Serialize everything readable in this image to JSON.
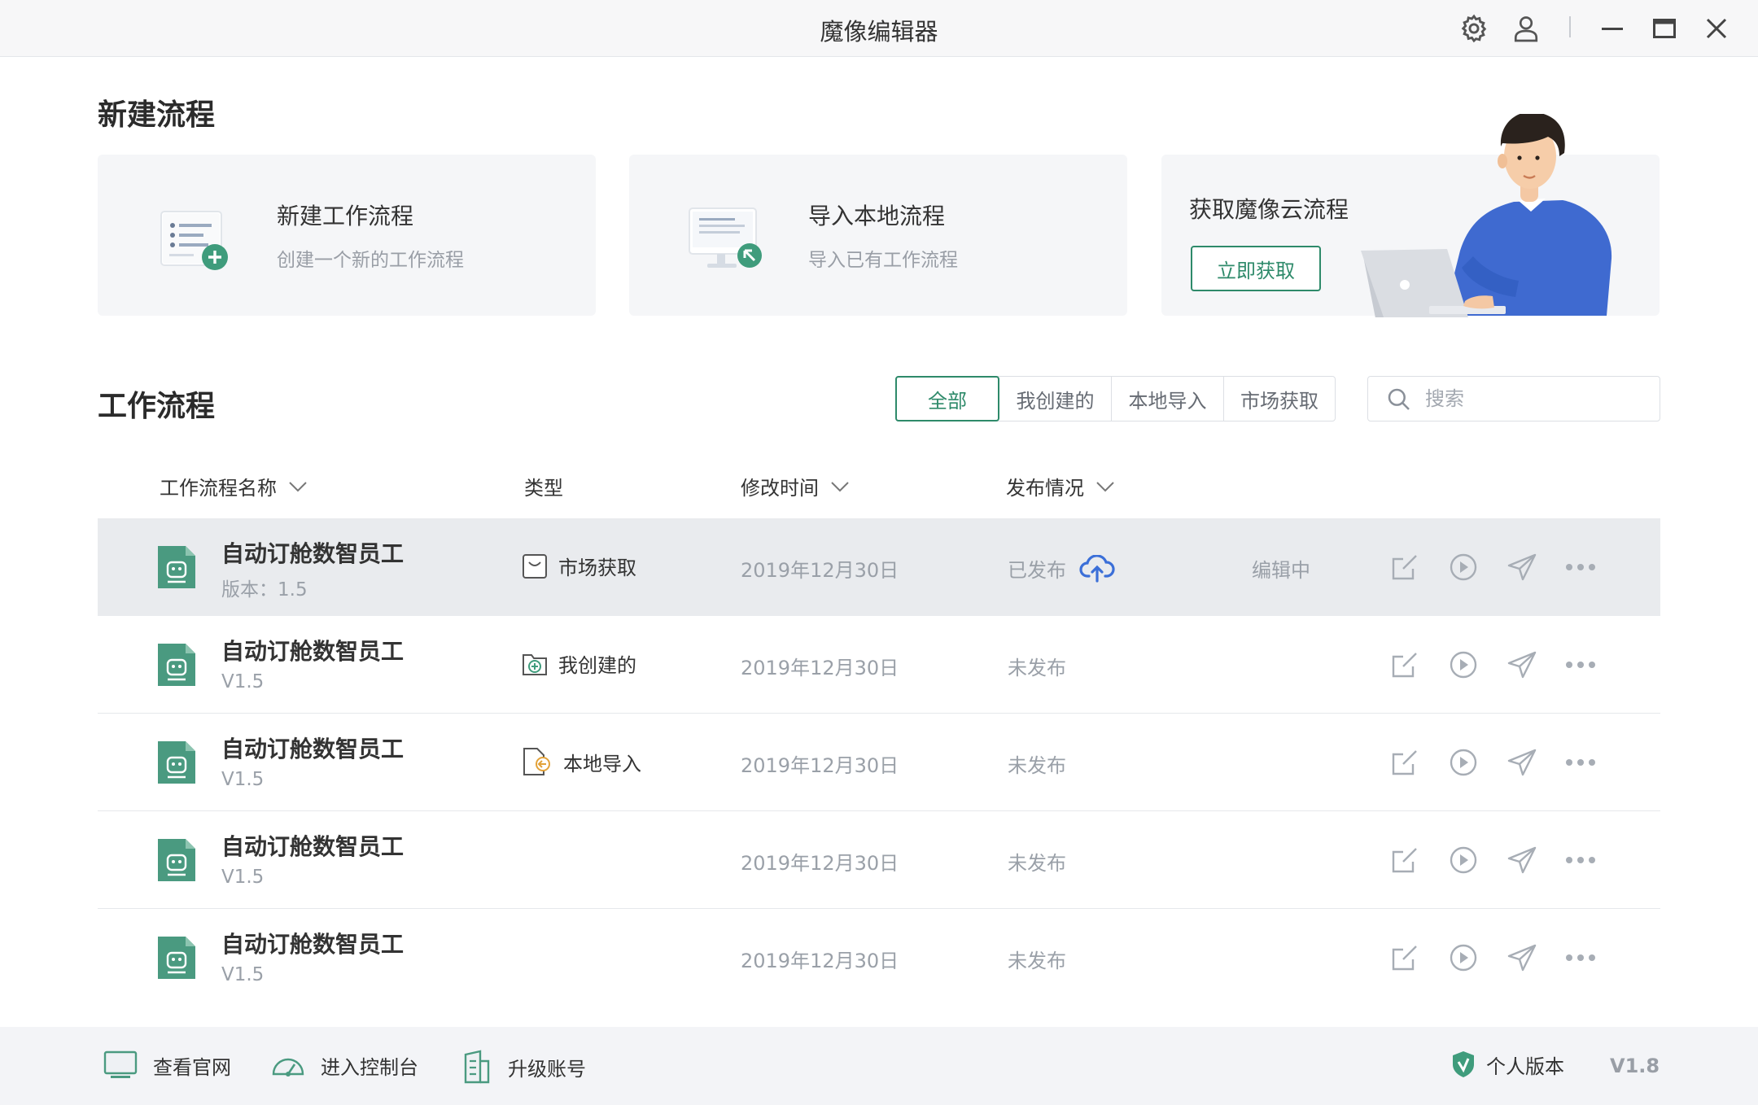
{
  "window": {
    "title": "魔像编辑器"
  },
  "new_section": {
    "heading": "新建流程",
    "cards": [
      {
        "title": "新建工作流程",
        "desc": "创建一个新的工作流程",
        "icon": "new-workflow-icon"
      },
      {
        "title": "导入本地流程",
        "desc": "导入已有工作流程",
        "icon": "import-local-icon"
      },
      {
        "title": "获取魔像云流程",
        "button": "立即获取",
        "icon": "person-laptop-illustration"
      }
    ]
  },
  "workflows": {
    "heading": "工作流程",
    "filters": [
      "全部",
      "我创建的",
      "本地导入",
      "市场获取"
    ],
    "active_filter": "全部",
    "search_placeholder": "搜索",
    "columns": {
      "name": "工作流程名称",
      "type": "类型",
      "modified": "修改时间",
      "publish": "发布情况"
    },
    "rows": [
      {
        "name": "自动订舱数智员工",
        "version_label": "版本：",
        "version": "1.5",
        "type": "市场获取",
        "type_icon": "market-bag-icon",
        "modified": "2019年12月30日",
        "publish": "已发布",
        "published": true,
        "status": "编辑中",
        "highlighted": true
      },
      {
        "name": "自动订舱数智员工",
        "version_label": "",
        "version": "V1.5",
        "type": "我创建的",
        "type_icon": "created-folder-icon",
        "modified": "2019年12月30日",
        "publish": "未发布",
        "published": false,
        "status": ""
      },
      {
        "name": "自动订舱数智员工",
        "version_label": "",
        "version": "V1.5",
        "type": "本地导入",
        "type_icon": "local-import-icon",
        "modified": "2019年12月30日",
        "publish": "未发布",
        "published": false,
        "status": ""
      },
      {
        "name": "自动订舱数智员工",
        "version_label": "",
        "version": "V1.5",
        "type": "",
        "type_icon": "",
        "modified": "2019年12月30日",
        "publish": "未发布",
        "published": false,
        "status": ""
      },
      {
        "name": "自动订舱数智员工",
        "version_label": "",
        "version": "V1.5",
        "type": "",
        "type_icon": "",
        "modified": "2019年12月30日",
        "publish": "未发布",
        "published": false,
        "status": ""
      }
    ],
    "row_actions": [
      "edit-icon",
      "run-icon",
      "send-icon",
      "more-icon"
    ]
  },
  "footer": {
    "links": [
      {
        "label": "查看官网",
        "icon": "monitor-icon"
      },
      {
        "label": "进入控制台",
        "icon": "dashboard-icon"
      },
      {
        "label": "升级账号",
        "icon": "building-icon"
      }
    ],
    "edition": "个人版本",
    "version": "V1.8"
  },
  "colors": {
    "accent": "#2e8a6a",
    "doc_icon": "#4a9a80",
    "blue": "#3b6fd8",
    "muted": "#9aa0a8"
  }
}
